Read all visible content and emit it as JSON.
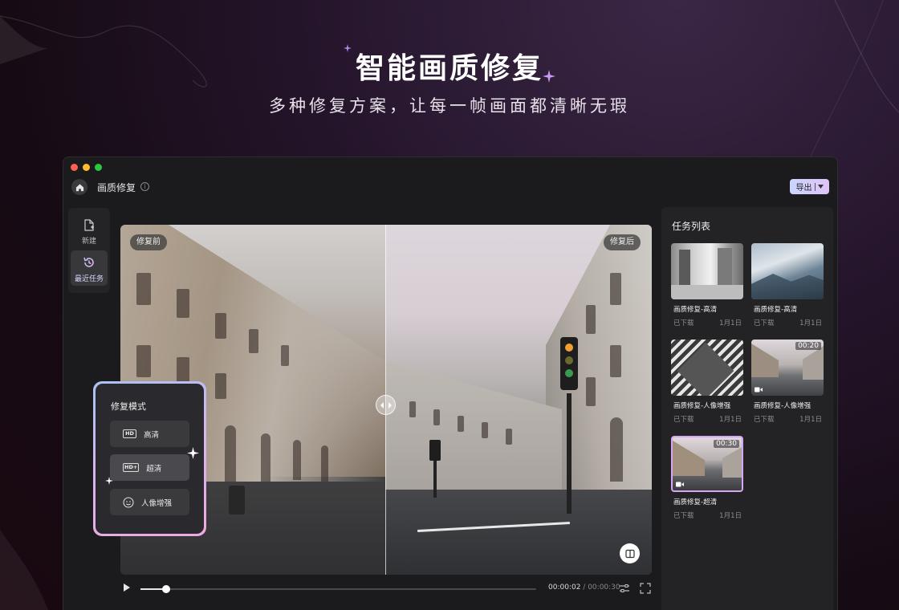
{
  "hero": {
    "title": "智能画质修复",
    "subtitle": "多种修复方案，让每一帧画面都清晰无瑕"
  },
  "window": {
    "title": "画质修复",
    "export_label": "导出",
    "traffic_lights": [
      "#ff5f57",
      "#febc2e",
      "#28c840"
    ]
  },
  "rail": {
    "items": [
      {
        "label": "新建",
        "icon": "new-file-icon",
        "active": false
      },
      {
        "label": "最近任务",
        "icon": "history-icon",
        "active": true
      }
    ]
  },
  "preview": {
    "before_label": "修复前",
    "after_label": "修复后"
  },
  "playback": {
    "current_time": "00:00:02",
    "total_time": "00:00:30",
    "progress": 0.065
  },
  "tasks": {
    "title": "任务列表",
    "items": [
      {
        "name": "画质修复-高清",
        "status": "已下载",
        "date": "1月1日",
        "duration": "",
        "video": false
      },
      {
        "name": "画质修复-高清",
        "status": "已下载",
        "date": "1月1日",
        "duration": "",
        "video": false
      },
      {
        "name": "画质修复-人像增强",
        "status": "已下载",
        "date": "1月1日",
        "duration": "",
        "video": false
      },
      {
        "name": "画质修复-人像增强",
        "status": "已下载",
        "date": "1月1日",
        "duration": "00:20",
        "video": true
      },
      {
        "name": "画质修复-超清",
        "status": "已下载",
        "date": "1月1日",
        "duration": "00:30",
        "video": true
      }
    ]
  },
  "modes": {
    "title": "修复模式",
    "options": [
      {
        "badge": "HD",
        "label": "高清",
        "selected": false
      },
      {
        "badge": "HD+",
        "label": "超清",
        "selected": true
      },
      {
        "badge": "",
        "label": "人像增强",
        "selected": false
      }
    ]
  },
  "colors": {
    "accent_gradient_start": "#a9c2f4",
    "accent_gradient_end": "#f0a8df",
    "window_bg": "#1b1b1d"
  }
}
